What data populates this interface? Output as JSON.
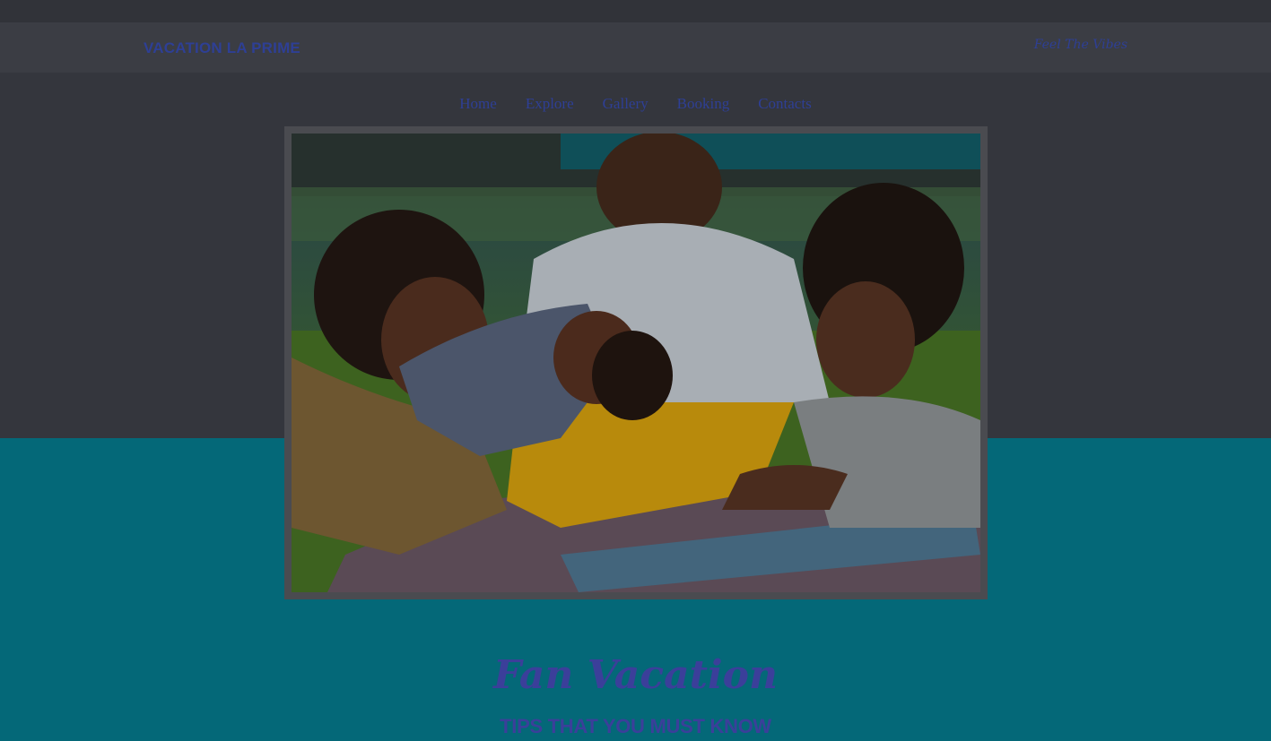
{
  "header": {
    "brand": "VACATION LA PRIME",
    "tagline": "Feel The Vibes"
  },
  "nav": {
    "items": [
      "Home",
      "Explore",
      "Gallery",
      "Booking",
      "Contacts"
    ]
  },
  "hero": {
    "image_icon": "family-photo-image"
  },
  "section": {
    "title": "Fan Vacation",
    "subtitle": "TIPS THAT YOU MUST KNOW"
  },
  "colors": {
    "overlay_background": "#34363d",
    "brand_text": "#2e3f95",
    "teal_band": "#046878",
    "heading_text": "#3b3f9a"
  }
}
